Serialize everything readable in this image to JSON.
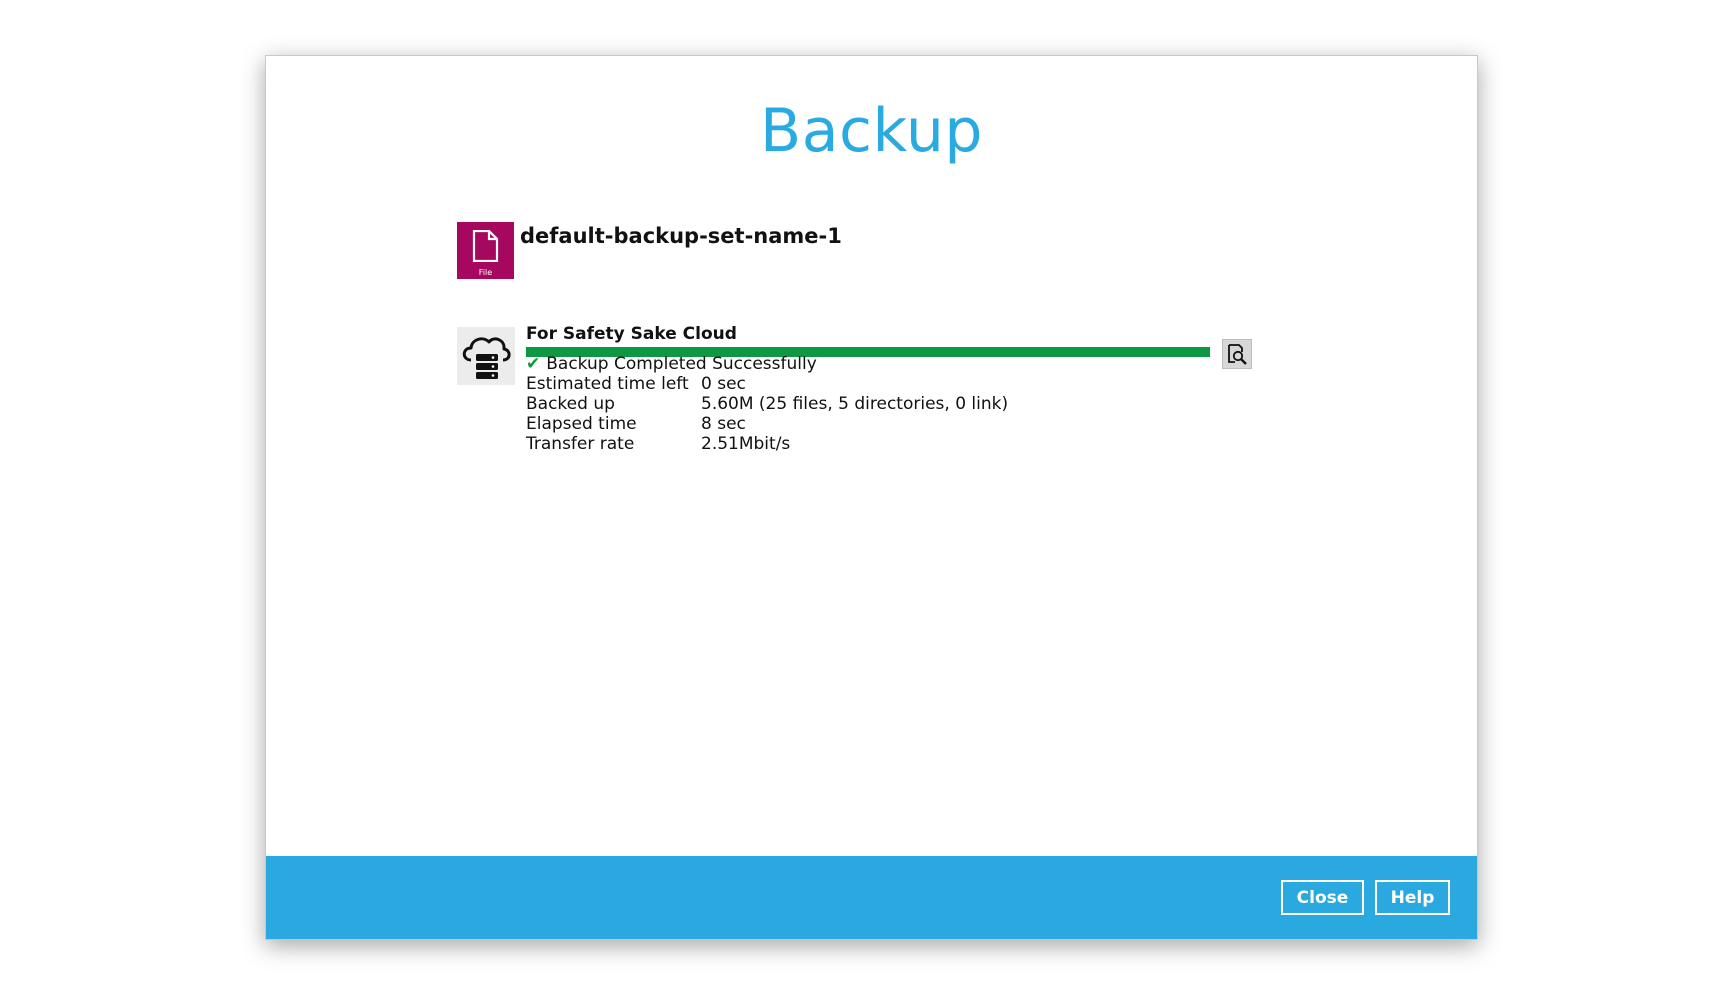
{
  "dialog": {
    "title": "Backup"
  },
  "backup_set": {
    "name": "default-backup-set-name-1",
    "type_icon": "file-icon",
    "type_caption": "File",
    "icon_color": "#a6075f"
  },
  "destination": {
    "name": "For Safety Sake Cloud",
    "icon": "cloud-server-icon",
    "progress_fraction": 1.0,
    "progress_color": "#0e9844",
    "status_icon": "checkmark-icon",
    "status_text": "Backup Completed Successfully",
    "stats": [
      {
        "label": "Estimated time left",
        "value": "0 sec"
      },
      {
        "label": "Backed up",
        "value": "5.60M (25 files, 5 directories, 0 link)"
      },
      {
        "label": "Elapsed time",
        "value": "8 sec"
      },
      {
        "label": "Transfer rate",
        "value": "2.51Mbit/s"
      }
    ],
    "detail_button_icon": "magnify-document-icon"
  },
  "footer": {
    "close_label": "Close",
    "help_label": "Help",
    "accent_color": "#29a9df"
  }
}
